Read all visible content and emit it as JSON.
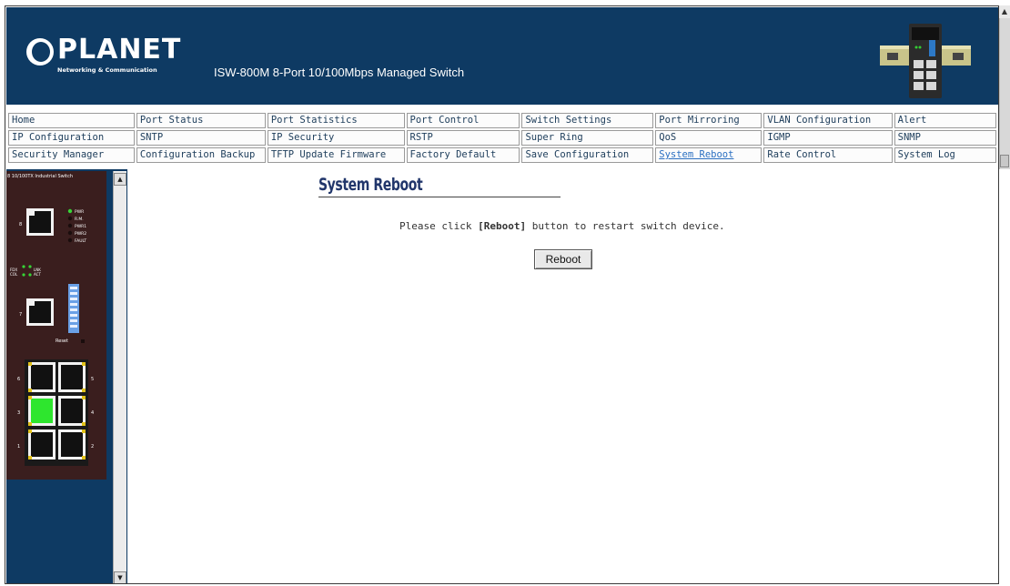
{
  "header": {
    "brand": "PLANET",
    "tagline": "Networking & Communication",
    "product_title": "ISW-800M 8-Port 10/100Mbps Managed Switch"
  },
  "nav": {
    "rows": [
      [
        "Home",
        "Port Status",
        "Port Statistics",
        "Port Control",
        "Switch Settings",
        "Port Mirroring",
        "VLAN Configuration",
        "Alert"
      ],
      [
        "IP Configuration",
        "SNTP",
        "IP Security",
        "RSTP",
        "Super Ring",
        "QoS",
        "IGMP",
        "SNMP"
      ],
      [
        "Security Manager",
        "Configuration Backup",
        "TFTP Update Firmware",
        "Factory Default",
        "Save Configuration",
        "System Reboot",
        "Rate Control",
        "System Log"
      ]
    ],
    "active": "System Reboot"
  },
  "device_panel": {
    "name": "8 10/100TX Industrial Switch",
    "led_labels": [
      "PWR",
      "R.M.",
      "PWR1",
      "PWR2",
      "FAULT"
    ],
    "port_led_labels": [
      "FDX",
      "COL",
      "LNK",
      "ACT"
    ],
    "reset_label": "Reset",
    "port_numbers": [
      "8",
      "7",
      "6",
      "5",
      "4",
      "3",
      "2",
      "1"
    ],
    "active_port": "3"
  },
  "main": {
    "title": "System Reboot",
    "instruction_prefix": "Please click ",
    "instruction_bold": "[Reboot]",
    "instruction_suffix": " button to restart switch device.",
    "reboot_button_label": "Reboot"
  },
  "colors": {
    "header_bg": "#0e3a63",
    "nav_text": "#1c3c5a",
    "active_link": "#2a6fc1",
    "title_text": "#21366b",
    "device_panel_bg": "#3a1e1e",
    "active_port": "#2ee62e",
    "led_green": "#36d536"
  }
}
